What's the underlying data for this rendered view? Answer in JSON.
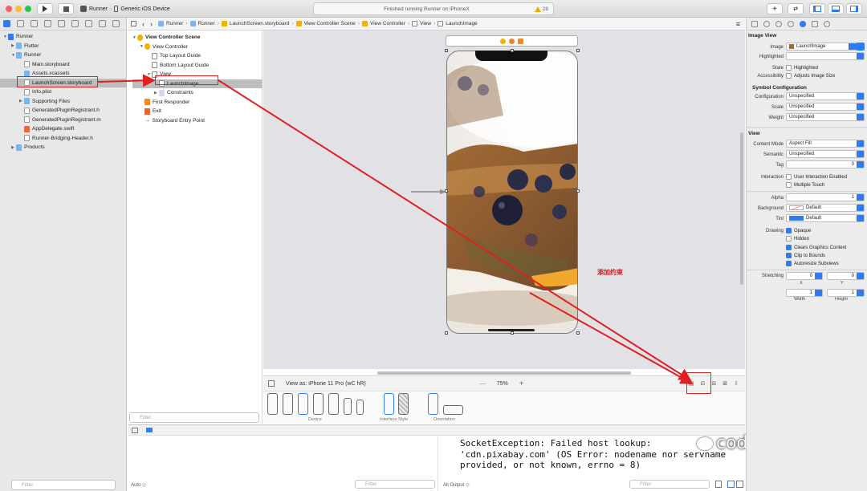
{
  "toolbar": {
    "scheme_app": "Runner",
    "scheme_device": "Generic iOS Device",
    "status_text": "Finished running Runner on iPhoneX",
    "warning_count": "28"
  },
  "navigator": {
    "items": [
      {
        "label": "Runner",
        "indent": 0,
        "icon": "project-icon",
        "open": true
      },
      {
        "label": "Flutter",
        "indent": 1,
        "icon": "folder-icon",
        "open": false
      },
      {
        "label": "Runner",
        "indent": 1,
        "icon": "folder-icon",
        "open": true
      },
      {
        "label": "Main.storyboard",
        "indent": 2,
        "icon": "file-icon"
      },
      {
        "label": "Assets.xcassets",
        "indent": 2,
        "icon": "folder-icon"
      },
      {
        "label": "LaunchScreen.storyboard",
        "indent": 2,
        "icon": "file-icon",
        "selected": true
      },
      {
        "label": "Info.plist",
        "indent": 2,
        "icon": "file-icon"
      },
      {
        "label": "Supporting Files",
        "indent": 2,
        "icon": "folder-icon",
        "open": false
      },
      {
        "label": "GeneratedPluginRegistrant.h",
        "indent": 2,
        "icon": "header-icon"
      },
      {
        "label": "GeneratedPluginRegistrant.m",
        "indent": 2,
        "icon": "header-icon"
      },
      {
        "label": "AppDelegate.swift",
        "indent": 2,
        "icon": "swift-icon"
      },
      {
        "label": "Runner-Bridging-Header.h",
        "indent": 2,
        "icon": "header-icon"
      },
      {
        "label": "Products",
        "indent": 1,
        "icon": "folder-icon",
        "open": false
      }
    ],
    "filter_placeholder": "Filter"
  },
  "jumpbar": {
    "crumbs": [
      "Runner",
      "Runner",
      "LaunchScreen.storyboard",
      "View Controller Scene",
      "View Controller",
      "View",
      "LaunchImage"
    ]
  },
  "outline": {
    "items": [
      {
        "label": "View Controller Scene",
        "indent": 0,
        "bold": true
      },
      {
        "label": "View Controller",
        "indent": 1
      },
      {
        "label": "Top Layout Guide",
        "indent": 2
      },
      {
        "label": "Bottom Layout Guide",
        "indent": 2
      },
      {
        "label": "View",
        "indent": 2
      },
      {
        "label": "LaunchImage",
        "indent": 3,
        "selected": true
      },
      {
        "label": "Constraints",
        "indent": 3
      },
      {
        "label": "First Responder",
        "indent": 1
      },
      {
        "label": "Exit",
        "indent": 1
      },
      {
        "label": "Storyboard Entry Point",
        "indent": 1
      }
    ],
    "filter_placeholder": "Filter"
  },
  "canvas": {
    "view_as": "View as: iPhone 11 Pro (wC hR)",
    "zoom": "75%",
    "annotation": "添加约束",
    "device_label": "Device",
    "interface_label": "Interface Style",
    "orientation_label": "Orientation"
  },
  "console": {
    "text": "SocketException: Failed host lookup:\n'cdn.pixabay.com' (OS Error: nodename nor servname\nprovided, or not known, errno = 8)",
    "auto_label": "Auto ◇",
    "filter_placeholder": "Filter",
    "output_label": "All Output ◇",
    "watermark": "coderwhy"
  },
  "inspector": {
    "image_view_title": "Image View",
    "image_label": "Image",
    "image_value": "LaunchImage",
    "highlighted_label": "Highlighted",
    "state_label": "State",
    "state_check": "Highlighted",
    "accessibility_label": "Accessibility",
    "accessibility_check": "Adjusts Image Size",
    "symbol_title": "Symbol Configuration",
    "configuration_label": "Configuration",
    "configuration_value": "Unspecified",
    "scale_label": "Scale",
    "scale_value": "Unspecified",
    "weight_label": "Weight",
    "weight_value": "Unspecified",
    "view_title": "View",
    "content_mode_label": "Content Mode",
    "content_mode_value": "Aspect Fill",
    "semantic_label": "Semantic",
    "semantic_value": "Unspecified",
    "tag_label": "Tag",
    "tag_value": "0",
    "interaction_label": "Interaction",
    "interaction_check1": "User Interaction Enabled",
    "interaction_check2": "Multiple Touch",
    "alpha_label": "Alpha",
    "alpha_value": "1",
    "background_label": "Background",
    "background_value": "Default",
    "tint_label": "Tint",
    "tint_value": "Default",
    "drawing_label": "Drawing",
    "drawing_checks": [
      "Opaque",
      "Hidden",
      "Clears Graphics Context",
      "Clip to Bounds",
      "Autoresize Subviews"
    ],
    "stretching_label": "Stretching",
    "stretch_x": "0",
    "stretch_y": "0",
    "stretch_w": "1",
    "stretch_h": "1",
    "x_label": "X",
    "y_label": "Y",
    "width_label": "Width",
    "height_label": "Height"
  }
}
